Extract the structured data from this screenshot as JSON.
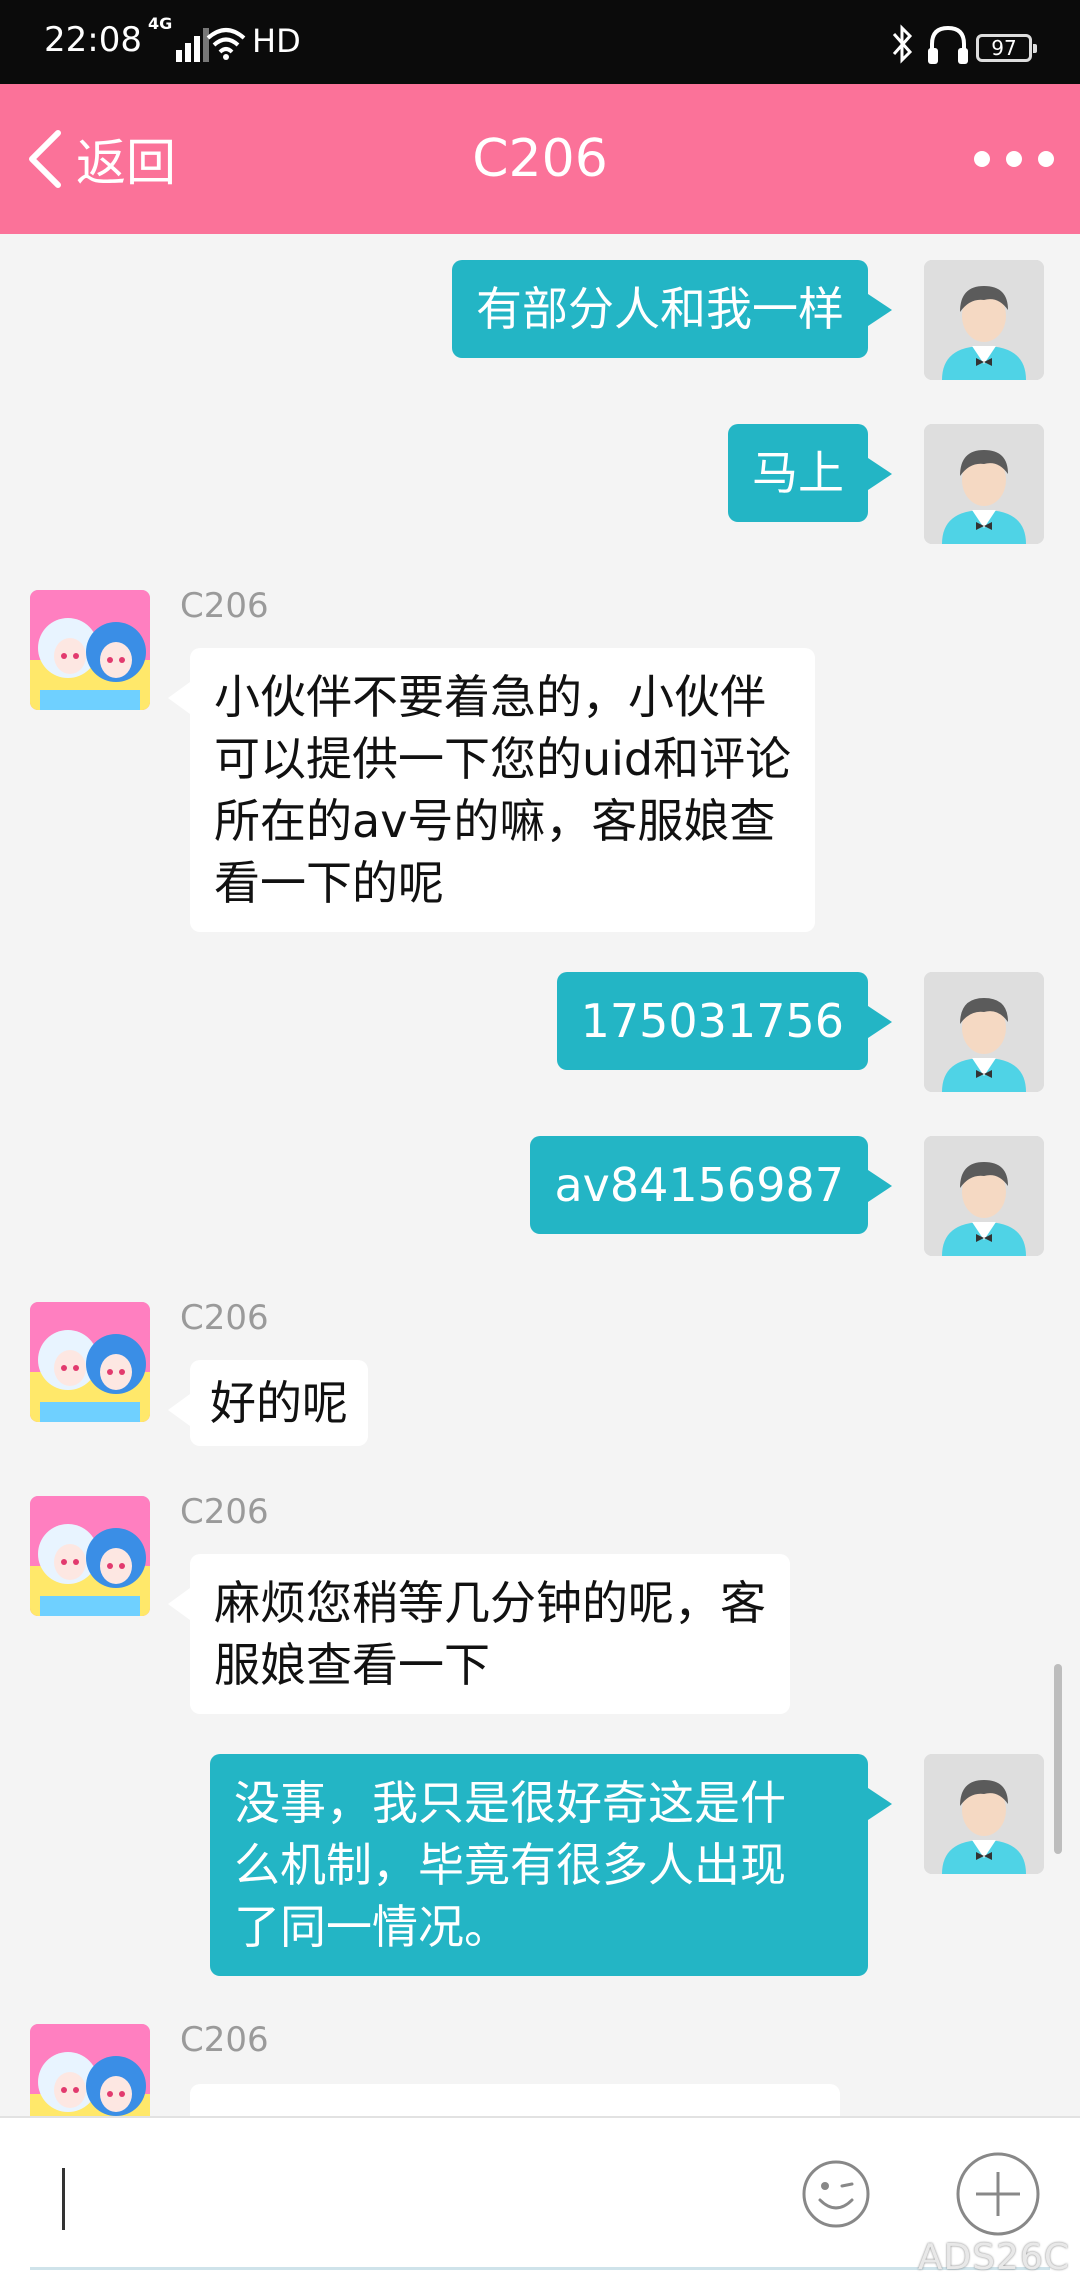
{
  "status": {
    "time": "22:08",
    "network": "4G",
    "hd": "HD",
    "battery": "97"
  },
  "nav": {
    "back_label": "返回",
    "title": "C206"
  },
  "messages": [
    {
      "from": "me",
      "text": "有部分人和我一样"
    },
    {
      "from": "me",
      "text": "马上"
    },
    {
      "from": "agent",
      "sender": "C206",
      "text": "小伙伴不要着急的，小伙伴\n可以提供一下您的uid和评论\n所在的av号的嘛，客服娘查\n看一下的呢"
    },
    {
      "from": "me",
      "text": "175031756"
    },
    {
      "from": "me",
      "text": "av84156987"
    },
    {
      "from": "agent",
      "sender": "C206",
      "text": "好的呢"
    },
    {
      "from": "agent",
      "sender": "C206",
      "text": "麻烦您稍等几分钟的呢，客\n服娘查看一下"
    },
    {
      "from": "me",
      "text": "没事，我只是很好奇这是什\n么机制，毕竟有很多人出现\n了同一情况。"
    },
    {
      "from": "agent",
      "sender": "C206",
      "text": ""
    }
  ],
  "input": {
    "value": ""
  },
  "watermark": "ADS26C",
  "colors": {
    "nav": "#fb7299",
    "sent_bubble": "#23b5c5",
    "recv_bubble": "#ffffff",
    "background": "#f4f4f4"
  }
}
